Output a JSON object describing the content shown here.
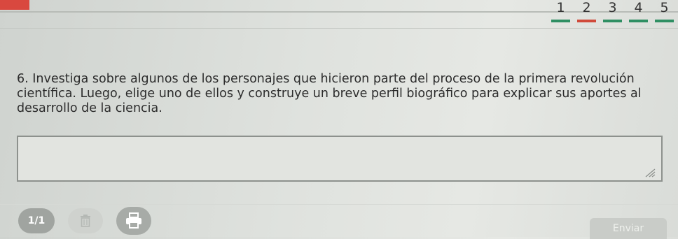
{
  "header": {
    "tabs": [
      {
        "label": "1",
        "active": false
      },
      {
        "label": "2",
        "active": true
      },
      {
        "label": "3",
        "active": false
      },
      {
        "label": "4",
        "active": false
      },
      {
        "label": "5",
        "active": false
      }
    ]
  },
  "question": {
    "text": "6. Investiga sobre algunos de los personajes que hicieron parte del proceso de la primera revolución científica. Luego, elige uno de ellos y construye un breve perfil biográfico para explicar sus aportes al desarrollo de la ciencia."
  },
  "answer": {
    "value": ""
  },
  "footer": {
    "page_indicator": "1/1",
    "send_label": "Enviar"
  },
  "colors": {
    "accent_red": "#d04a3a",
    "tab_green": "#2f8f63",
    "badge_gray": "#a0a4a0"
  }
}
